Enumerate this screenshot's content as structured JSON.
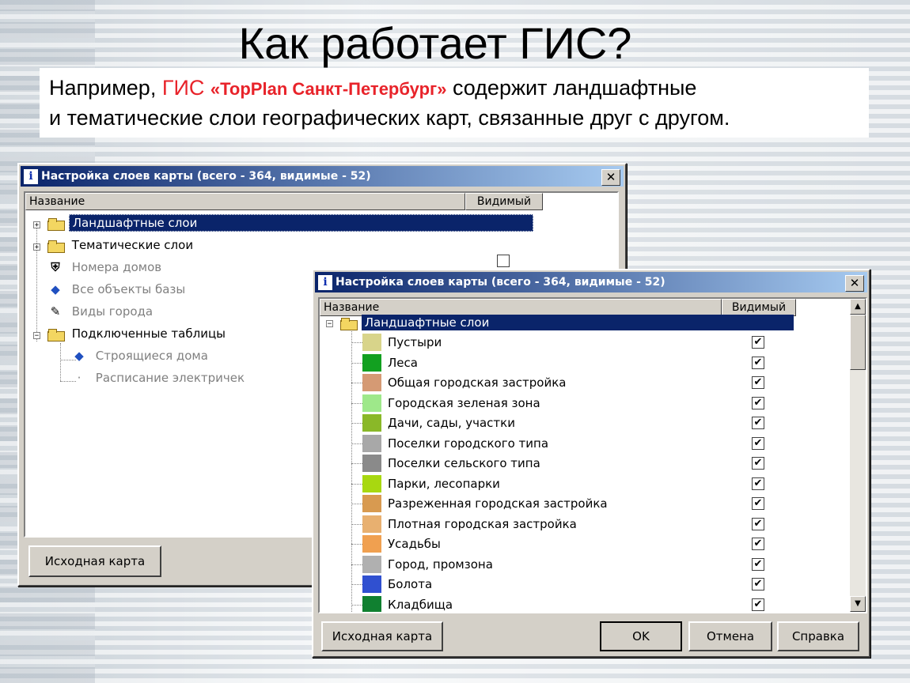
{
  "slide": {
    "title": "Как работает ГИС?",
    "intro_pre": "Например, ",
    "intro_gis": "ГИС ",
    "intro_brand": "«TopPlan Санкт-Петербург»",
    "intro_post": " содержит ландшафтные",
    "intro_line2": "и тематические слои географических карт, связанные друг с другом."
  },
  "dialog1": {
    "title": "Настройка слоев карты (всего - 364, видимые - 52)",
    "col_name": "Название",
    "col_visible": "Видимый",
    "tree": [
      {
        "label": "Ландшафтные слои",
        "icon": "folder-icon",
        "state": "selected"
      },
      {
        "label": "Тематические слои",
        "icon": "folder-icon",
        "state": "normal"
      },
      {
        "label": "Номера домов",
        "icon": "house-number-icon",
        "state": "disabled"
      },
      {
        "label": "Все объекты базы",
        "icon": "diamond-icon",
        "state": "disabled"
      },
      {
        "label": "Виды города",
        "icon": "camera-icon",
        "state": "disabled"
      },
      {
        "label": "Подключенные таблицы",
        "icon": "folder-icon",
        "state": "normal"
      },
      {
        "label": "Строящиеся дома",
        "icon": "diamond-icon",
        "state": "disabled"
      },
      {
        "label": "Расписание электричек",
        "icon": "dot-icon",
        "state": "disabled"
      }
    ],
    "btn_source": "Исходная карта"
  },
  "dialog2": {
    "title": "Настройка слоев карты (всего - 364, видимые - 52)",
    "col_name": "Название",
    "col_visible": "Видимый",
    "root": "Ландшафтные слои",
    "layers": [
      {
        "label": "Пустыри",
        "color": "#d8d48a",
        "checked": true
      },
      {
        "label": "Леса",
        "color": "#12a020",
        "checked": true
      },
      {
        "label": "Общая городская застройка",
        "color": "#d59a74",
        "checked": true
      },
      {
        "label": "Городская зеленая зона",
        "color": "#9ee88a",
        "checked": true
      },
      {
        "label": "Дачи, сады, участки",
        "color": "#8ab828",
        "checked": true
      },
      {
        "label": "Поселки городского типа",
        "color": "#a8a8a8",
        "checked": true
      },
      {
        "label": "Поселки сельского типа",
        "color": "#8a8a8a",
        "checked": true
      },
      {
        "label": "Парки, лесопарки",
        "color": "#a8d810",
        "checked": true
      },
      {
        "label": "Разреженная городская застройка",
        "color": "#d89a50",
        "checked": true
      },
      {
        "label": "Плотная городская застройка",
        "color": "#e8b070",
        "checked": true
      },
      {
        "label": "Усадьбы",
        "color": "#f0a050",
        "checked": true
      },
      {
        "label": "Город, промзона",
        "color": "#b0b0b0",
        "checked": true
      },
      {
        "label": "Болота",
        "color": "#3050d0",
        "checked": true
      },
      {
        "label": "Кладбища",
        "color": "#108030",
        "checked": true
      }
    ],
    "btn_source": "Исходная карта",
    "btn_ok": "OK",
    "btn_cancel": "Отмена",
    "btn_help": "Справка"
  },
  "icons": {
    "close": "close-icon",
    "info": "info-icon",
    "folder": "folder-icon"
  },
  "colors": {
    "titlebar_start": "#0a246a",
    "titlebar_end": "#a6caf0",
    "selection": "#0a246a",
    "accent_red": "#e8232a"
  }
}
